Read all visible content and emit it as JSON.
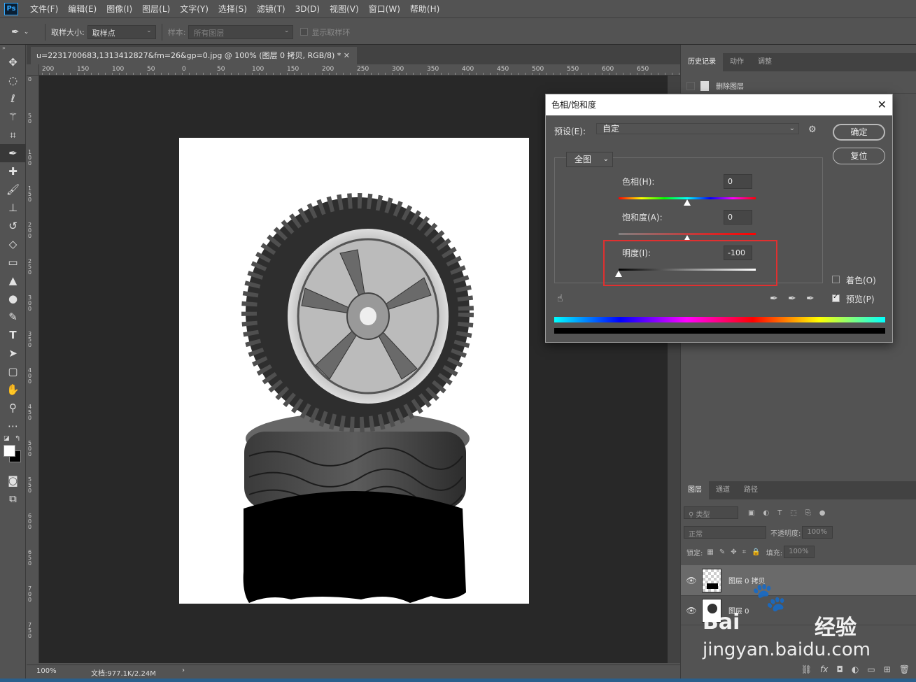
{
  "app": {
    "logo": "Ps"
  },
  "menu": [
    "文件(F)",
    "编辑(E)",
    "图像(I)",
    "图层(L)",
    "文字(Y)",
    "选择(S)",
    "滤镜(T)",
    "3D(D)",
    "视图(V)",
    "窗口(W)",
    "帮助(H)"
  ],
  "options": {
    "sample_size_label": "取样大小:",
    "sample_size_value": "取样点",
    "sample_label": "样本:",
    "sample_value": "所有图层",
    "show_ring_label": "显示取样环"
  },
  "document": {
    "tab_title": "u=2231700683,1313412827&fm=26&gp=0.jpg @ 100% (图层 0 拷贝, RGB/8) *",
    "ruler_h": [
      "200",
      "150",
      "100",
      "50",
      "0",
      "50",
      "100",
      "150",
      "200",
      "250",
      "300",
      "350",
      "400",
      "450",
      "500",
      "550",
      "600",
      "650"
    ],
    "ruler_v": [
      "0",
      "5 0",
      "1 0 0",
      "1 5 0",
      "2 0 0",
      "2 5 0",
      "3 0 0",
      "3 5 0",
      "4 0 0",
      "4 5 0",
      "5 0 0",
      "5 5 0",
      "6 0 0",
      "6 5 0",
      "7 0 0",
      "7 5 0"
    ],
    "zoom": "100%",
    "doc_info": "文档:977.1K/2.24M"
  },
  "panels": {
    "history_tabs": [
      "历史记录",
      "动作",
      "调整"
    ],
    "history_item": "删除图层",
    "layer_tabs": [
      "图层",
      "通道",
      "路径"
    ],
    "filter_kind": "类型",
    "blend_mode": "正常",
    "opacity_label": "不透明度:",
    "opacity_value": "100%",
    "lock_label": "锁定:",
    "fill_label": "填充:",
    "fill_value": "100%",
    "layers": [
      {
        "name": "图层 0 拷贝"
      },
      {
        "name": "图层 0"
      }
    ]
  },
  "dialog": {
    "title": "色相/饱和度",
    "preset_label": "预设(E):",
    "preset_value": "自定",
    "ok": "确定",
    "reset": "复位",
    "channel": "全图",
    "hue_label": "色相(H):",
    "hue_value": "0",
    "saturation_label": "饱和度(A):",
    "saturation_value": "0",
    "lightness_label": "明度(I):",
    "lightness_value": "-100",
    "colorize_label": "着色(O)",
    "preview_label": "预览(P)",
    "colorize_checked": false,
    "preview_checked": true,
    "hue_level": 0.5,
    "saturation_level": 0.5,
    "lightness_level": 0.0
  },
  "watermark": {
    "brand": "Bai",
    "brand2": "经验",
    "url": "jingyan.baidu.com"
  }
}
